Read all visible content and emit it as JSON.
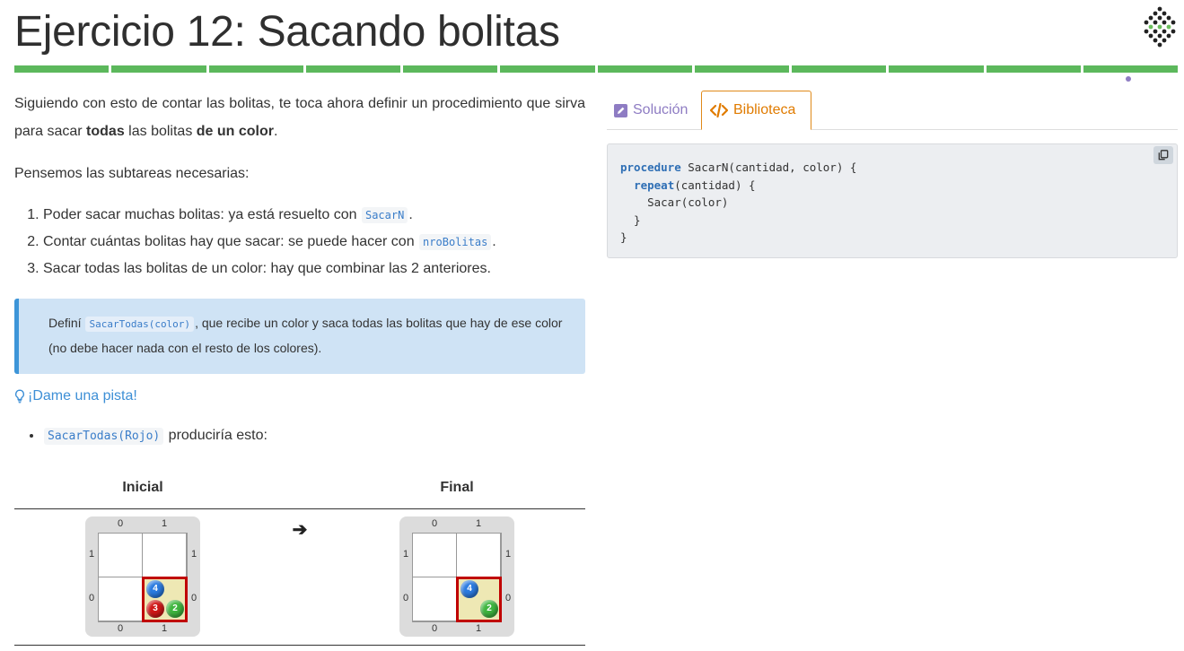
{
  "header": {
    "title": "Ejercicio 12: Sacando bolitas",
    "progress_segments": 12,
    "progress_color": "#5cb85c"
  },
  "statement": {
    "intro_before": "Siguiendo con esto de contar las bolitas, te toca ahora definir un procedimiento que sirva para sacar ",
    "intro_bold1": "todas",
    "intro_mid": " las bolitas ",
    "intro_bold2": "de un color",
    "intro_end": ".",
    "subtasks_intro": "Pensemos las subtareas necesarias:",
    "steps": [
      {
        "text": "Poder sacar muchas bolitas: ya está resuelto con ",
        "code": "SacarN",
        "end": "."
      },
      {
        "text": "Contar cuántas bolitas hay que sacar: se puede hacer con ",
        "code": "nroBolitas",
        "end": "."
      },
      {
        "text": "Sacar todas las bolitas de un color: hay que combinar las 2 anteriores.",
        "code": "",
        "end": ""
      }
    ]
  },
  "callout": {
    "prefix": "Definí ",
    "code": "SacarTodas(color)",
    "suffix": ", que recibe un color y saca todas las bolitas que hay de ese color (no debe hacer nada con el resto de los colores)."
  },
  "hint": {
    "label": "¡Dame una pista!",
    "icon": "lightbulb-icon"
  },
  "example": {
    "code": "SacarTodas(Rojo)",
    "text": " produciría esto:"
  },
  "boards": {
    "initial_label": "Inicial",
    "final_label": "Final",
    "arrow": "➔",
    "col_labels": [
      "0",
      "1"
    ],
    "row_labels": [
      "1",
      "0"
    ],
    "initial_balls": [
      {
        "color": "blue",
        "count": "4"
      },
      {
        "color": "red",
        "count": "3"
      },
      {
        "color": "green",
        "count": "2"
      }
    ],
    "final_balls": [
      {
        "color": "blue",
        "count": "4"
      },
      {
        "color": "green",
        "count": "2"
      }
    ]
  },
  "tabs": {
    "solution": "Solución",
    "library": "Biblioteca"
  },
  "library_code": {
    "lines": [
      {
        "kw": "procedure",
        "rest": " SacarN(cantidad, color) {"
      },
      {
        "kw": "  repeat",
        "rest": "(cantidad) {"
      },
      {
        "kw": "",
        "rest": "    Sacar(color)"
      },
      {
        "kw": "",
        "rest": "  }"
      },
      {
        "kw": "",
        "rest": "}"
      }
    ],
    "copy_icon": "copy-icon"
  }
}
